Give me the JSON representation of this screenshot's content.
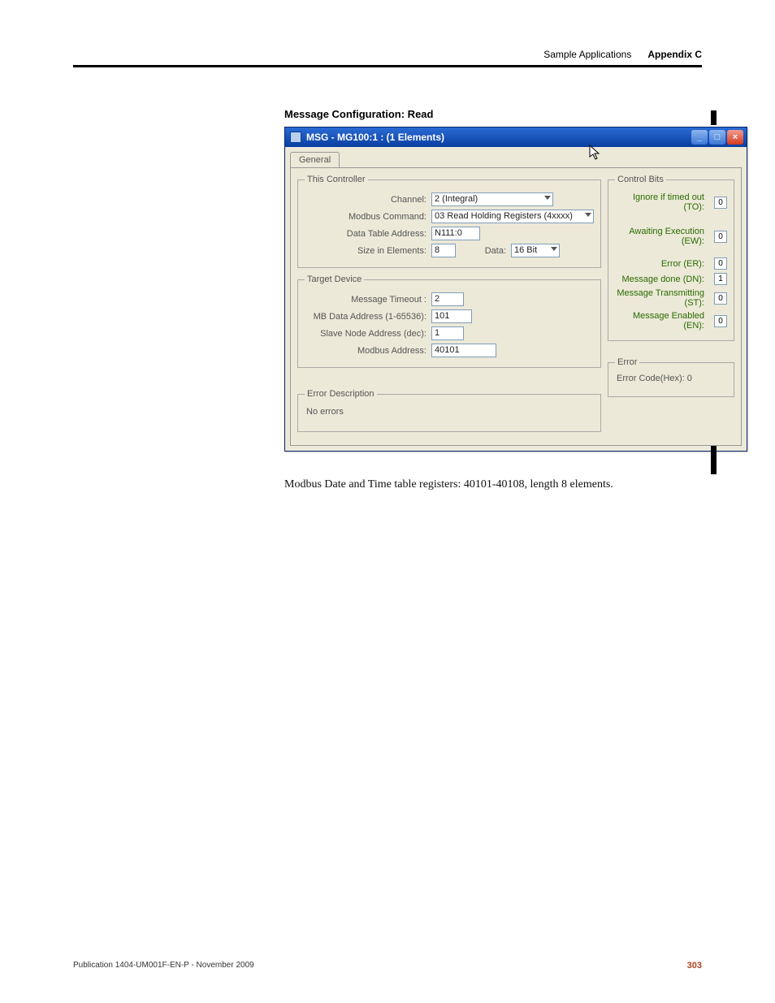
{
  "header": {
    "section": "Sample Applications",
    "appendix": "Appendix C"
  },
  "caption": "Message Configuration: Read",
  "window": {
    "title": "MSG - MG100:1 : (1 Elements)",
    "tab": "General",
    "this_controller": {
      "legend": "This Controller",
      "channel_label": "Channel:",
      "channel_value": "2 (Integral)",
      "modbus_command_label": "Modbus Command:",
      "modbus_command_value": "03 Read Holding Registers (4xxxx)",
      "data_table_label": "Data Table Address:",
      "data_table_value": "N111:0",
      "size_label": "Size in Elements:",
      "size_value": "8",
      "data_label": "Data:",
      "data_value": "16 Bit"
    },
    "target_device": {
      "legend": "Target Device",
      "message_timeout_label": "Message Timeout :",
      "message_timeout_value": "2",
      "mb_data_addr_label": "MB Data Address (1-65536):",
      "mb_data_addr_value": "101",
      "slave_node_label": "Slave Node Address (dec):",
      "slave_node_value": "1",
      "modbus_addr_label": "Modbus Address:",
      "modbus_addr_value": "40101"
    },
    "control_bits": {
      "legend": "Control Bits",
      "to_label": "Ignore if timed out (TO):",
      "to_value": "0",
      "ew_label": "Awaiting Execution (EW):",
      "ew_value": "0",
      "er_label": "Error (ER):",
      "er_value": "0",
      "dn_label": "Message done (DN):",
      "dn_value": "1",
      "st_label": "Message Transmitting (ST):",
      "st_value": "0",
      "en_label": "Message Enabled (EN):",
      "en_value": "0"
    },
    "error_box": {
      "legend": "Error",
      "error_code_label": "Error Code(Hex): 0"
    },
    "error_desc": {
      "legend": "Error Description",
      "text": "No errors"
    }
  },
  "note": "Modbus Date and Time table registers:  40101-40108, length 8 elements.",
  "footer": {
    "pub": "Publication 1404-UM001F-EN-P - November 2009",
    "page": "303"
  }
}
